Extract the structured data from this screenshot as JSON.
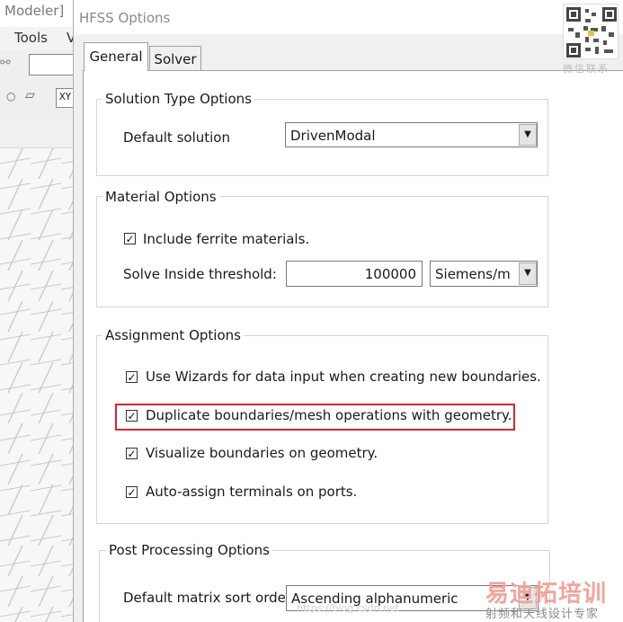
{
  "background_app": {
    "title": "Modeler]",
    "menu": {
      "tools": "Tools",
      "v": "V"
    },
    "field_text": "XY"
  },
  "dialog": {
    "title": "HFSS Options",
    "tabs": [
      {
        "label": "General",
        "active": true
      },
      {
        "label": "Solver",
        "active": false
      }
    ],
    "solution_type": {
      "legend": "Solution Type Options",
      "default_solution_label": "Default solution",
      "default_solution_value": "DrivenModal"
    },
    "material": {
      "legend": "Material Options",
      "ferrite_label": "Include ferrite materials.",
      "ferrite_checked": true,
      "threshold_label": "Solve Inside threshold:",
      "threshold_value": "100000",
      "threshold_unit": "Siemens/m"
    },
    "assignment": {
      "legend": "Assignment Options",
      "items": [
        {
          "label": "Use Wizards for data input when creating new boundaries.",
          "checked": true
        },
        {
          "label": "Duplicate boundaries/mesh operations with geometry.",
          "checked": true
        },
        {
          "label": "Visualize boundaries on geometry.",
          "checked": true
        },
        {
          "label": "Auto-assign terminals on ports.",
          "checked": true
        }
      ]
    },
    "post_processing": {
      "legend": "Post Processing Options",
      "sort_label": "Default matrix sort orde",
      "sort_value": "Ascending alphanumeric"
    }
  },
  "overlays": {
    "qr_caption": "微信联系",
    "watermark_logo": "易迪拓培训",
    "watermark_sub": "射频和天线设计专家",
    "watermark_url": "https://blog.csdn.net"
  },
  "colors": {
    "highlight": "#d9252f",
    "dialog_bg": "#f0f0f0",
    "panel_bg": "#ffffff"
  }
}
